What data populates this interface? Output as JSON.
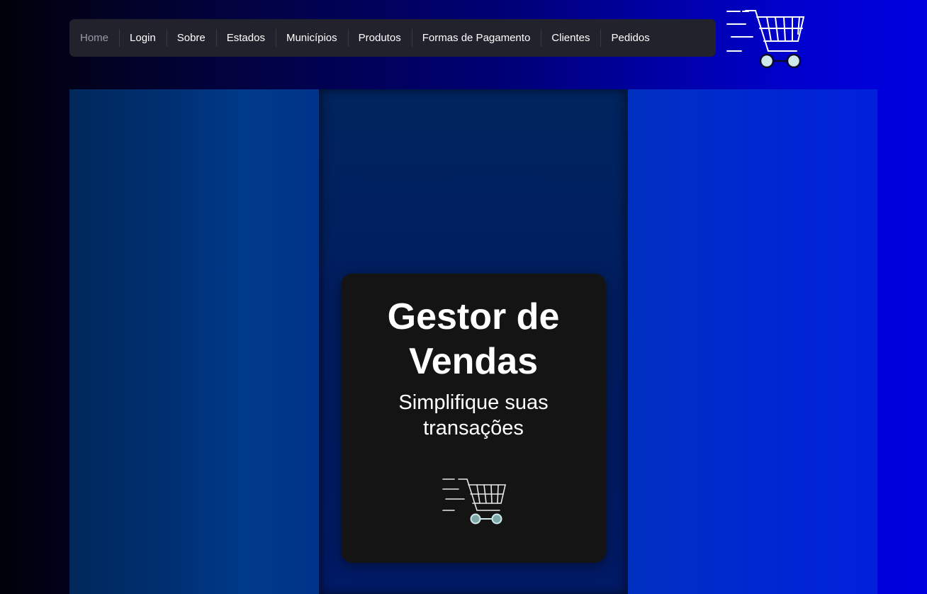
{
  "nav": {
    "items": [
      {
        "label": "Home",
        "active": true
      },
      {
        "label": "Login"
      },
      {
        "label": "Sobre"
      },
      {
        "label": "Estados"
      },
      {
        "label": "Municípios"
      },
      {
        "label": "Produtos"
      },
      {
        "label": "Formas de Pagamento"
      },
      {
        "label": "Clientes"
      },
      {
        "label": "Pedidos"
      }
    ]
  },
  "header": {
    "logo_icon": "shopping-cart-icon"
  },
  "hero": {
    "title": "Gestor de Vendas",
    "subtitle": "Simplifique suas transações",
    "icon": "shopping-cart-icon"
  },
  "colors": {
    "navbar_bg": "#22222c",
    "card_bg": "#141414",
    "wheel": "#cfe8ea"
  }
}
